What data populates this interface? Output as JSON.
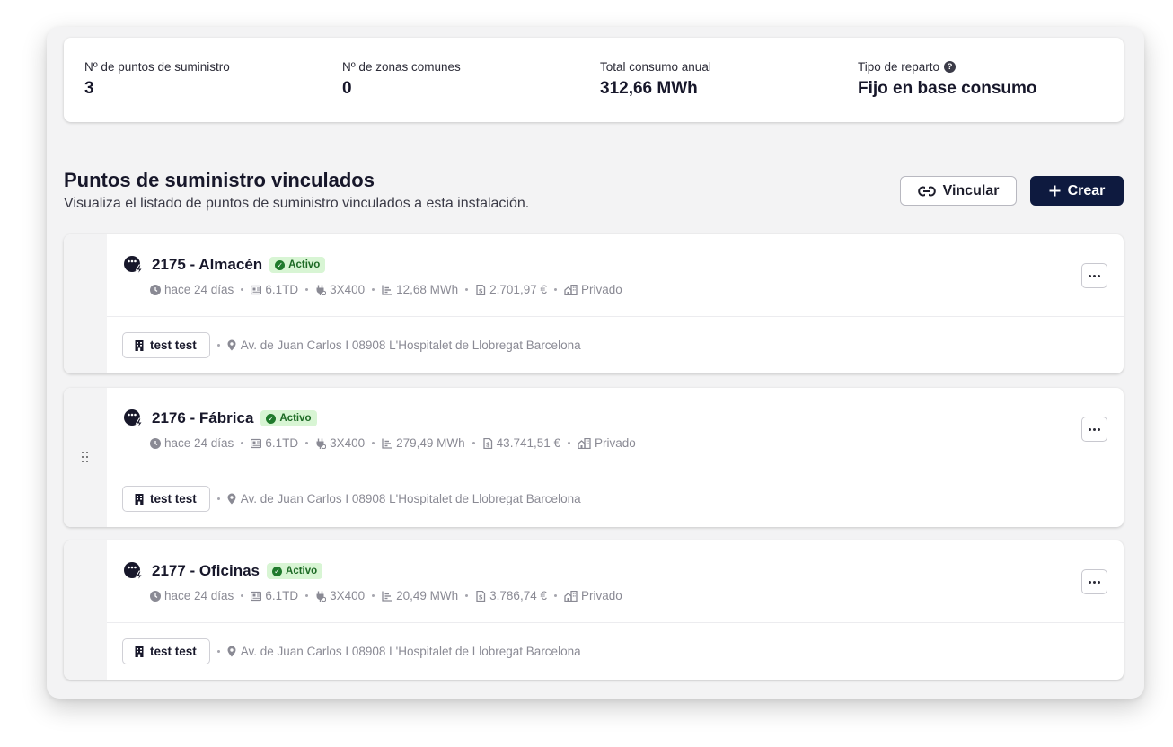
{
  "stats": [
    {
      "label": "Nº de puntos de suministro",
      "value": "3"
    },
    {
      "label": "Nº de zonas comunes",
      "value": "0"
    },
    {
      "label": "Total consumo anual",
      "value": "312,66 MWh"
    },
    {
      "label": "Tipo de reparto",
      "value": "Fijo en base consumo",
      "help_icon": "help-icon"
    }
  ],
  "section": {
    "title": "Puntos de suministro vinculados",
    "subtitle": "Visualiza el listado de puntos de suministro vinculados a esta instalación."
  },
  "actions": {
    "link_label": "Vincular",
    "create_label": "Crear"
  },
  "cards": [
    {
      "title": "2175 - Almacén",
      "status": "Activo",
      "updated": "hace 24 días",
      "tariff": "6.1TD",
      "voltage": "3X400",
      "consumption": "12,68 MWh",
      "cost": "2.701,97 €",
      "ownership": "Privado",
      "tag": "test test",
      "address": "Av. de Juan Carlos I 08908 L'Hospitalet de Llobregat Barcelona"
    },
    {
      "title": "2176 - Fábrica",
      "status": "Activo",
      "updated": "hace 24 días",
      "tariff": "6.1TD",
      "voltage": "3X400",
      "consumption": "279,49 MWh",
      "cost": "43.741,51 €",
      "ownership": "Privado",
      "tag": "test test",
      "address": "Av. de Juan Carlos I 08908 L'Hospitalet de Llobregat Barcelona"
    },
    {
      "title": "2177 - Oficinas",
      "status": "Activo",
      "updated": "hace 24 días",
      "tariff": "6.1TD",
      "voltage": "3X400",
      "consumption": "20,49 MWh",
      "cost": "3.786,74 €",
      "ownership": "Privado",
      "tag": "test test",
      "address": "Av. de Juan Carlos I 08908 L'Hospitalet de Llobregat Barcelona"
    }
  ],
  "colors": {
    "primary": "#0e1a3f",
    "badge_bg": "#d8f5d4",
    "badge_text": "#1d6a25",
    "panel_bg": "#f3f3f4"
  }
}
